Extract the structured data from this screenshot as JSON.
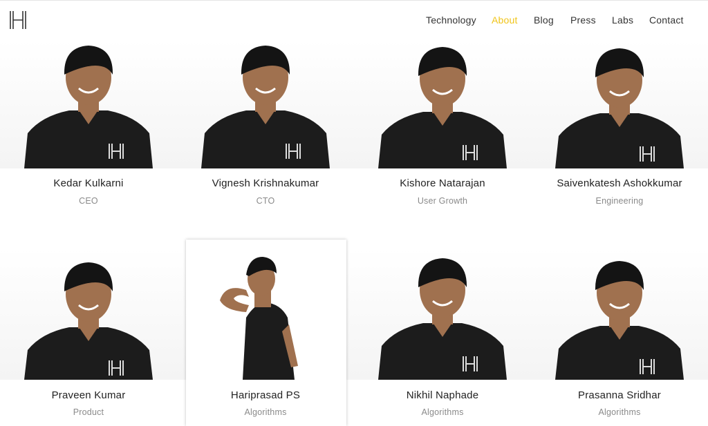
{
  "brand": {
    "logo_icon": "h-monogram-logo"
  },
  "nav": {
    "items": [
      {
        "label": "Technology",
        "active": false
      },
      {
        "label": "About",
        "active": true
      },
      {
        "label": "Blog",
        "active": false
      },
      {
        "label": "Press",
        "active": false
      },
      {
        "label": "Labs",
        "active": false
      },
      {
        "label": "Contact",
        "active": false
      }
    ],
    "active_color": "#f0c419"
  },
  "team": [
    {
      "name": "Kedar Kulkarni",
      "role": "CEO"
    },
    {
      "name": "Vignesh Krishnakumar",
      "role": "CTO"
    },
    {
      "name": "Kishore Natarajan",
      "role": "User Growth"
    },
    {
      "name": "Saivenkatesh Ashokkumar",
      "role": "Engineering"
    },
    {
      "name": "Praveen Kumar",
      "role": "Product"
    },
    {
      "name": "Hariprasad PS",
      "role": "Algorithms"
    },
    {
      "name": "Nikhil Naphade",
      "role": "Algorithms"
    },
    {
      "name": "Prasanna Sridhar",
      "role": "Algorithms"
    }
  ],
  "colors": {
    "shirt": "#1c1c1c",
    "skin": "#a0714f",
    "hair": "#141414"
  }
}
